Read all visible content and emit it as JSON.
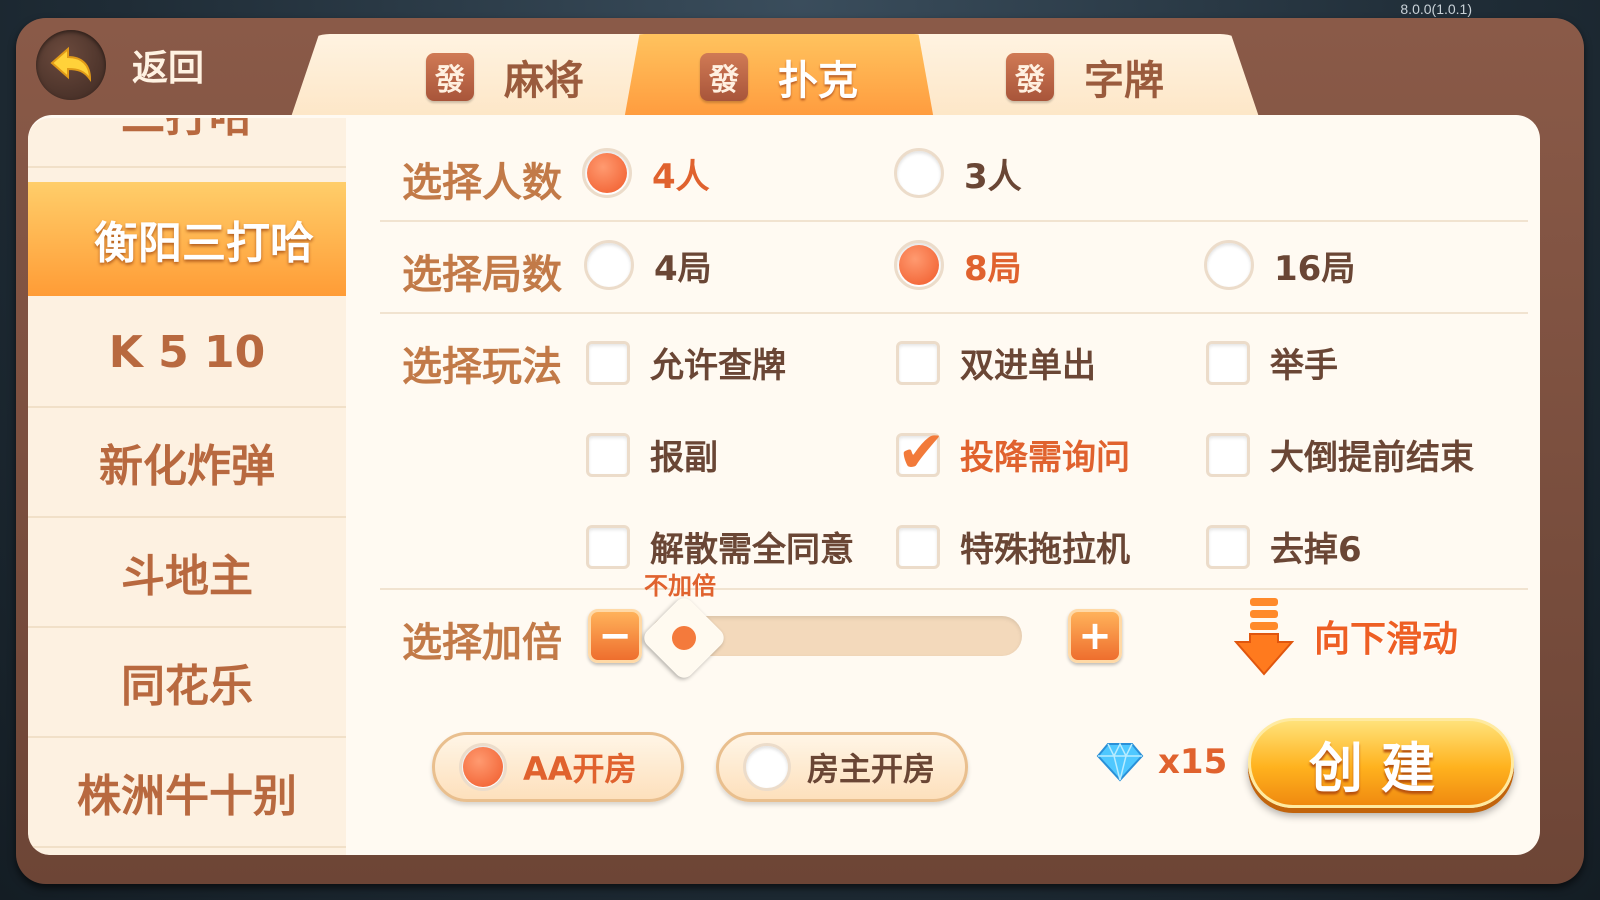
{
  "version": "8.0.0(1.0.1)",
  "back": {
    "label": "返回"
  },
  "tabs": [
    {
      "icon": "發",
      "label": "麻将"
    },
    {
      "icon": "發",
      "label": "扑克"
    },
    {
      "icon": "發",
      "label": "字牌"
    }
  ],
  "active_tab": "扑克",
  "sidebar": {
    "items": [
      {
        "label": "二打哈"
      },
      {
        "label": "衡阳三打哈"
      },
      {
        "label": "K 5 10"
      },
      {
        "label": "新化炸弹"
      },
      {
        "label": "斗地主"
      },
      {
        "label": "同花乐"
      },
      {
        "label": "株洲牛十别"
      }
    ],
    "active": "衡阳三打哈"
  },
  "rows": {
    "players": {
      "label": "选择人数",
      "options": [
        {
          "label": "4人",
          "selected": true
        },
        {
          "label": "3人",
          "selected": false
        }
      ]
    },
    "rounds": {
      "label": "选择局数",
      "options": [
        {
          "label": "4局",
          "selected": false
        },
        {
          "label": "8局",
          "selected": true
        },
        {
          "label": "16局",
          "selected": false
        }
      ]
    },
    "rules": {
      "label": "选择玩法",
      "options": [
        {
          "label": "允许查牌",
          "checked": false
        },
        {
          "label": "双进单出",
          "checked": false
        },
        {
          "label": "举手",
          "checked": false
        },
        {
          "label": "报副",
          "checked": false
        },
        {
          "label": "投降需询问",
          "checked": true
        },
        {
          "label": "大倒提前结束",
          "checked": false
        },
        {
          "label": "解散需全同意",
          "checked": false
        },
        {
          "label": "特殊拖拉机",
          "checked": false
        },
        {
          "label": "去掉6",
          "checked": false
        }
      ]
    },
    "multiplier": {
      "label": "选择加倍",
      "value_text": "不加倍",
      "level": 0,
      "minus": "−",
      "plus": "+"
    }
  },
  "scroll_hint": "向下滑动",
  "payment": {
    "options": [
      {
        "label": "AA开房",
        "selected": true
      },
      {
        "label": "房主开房",
        "selected": false
      }
    ]
  },
  "cost": {
    "icon": "diamond-icon",
    "text": "x15"
  },
  "create_label": "创建",
  "colors": {
    "accent": "#f05a2a",
    "label": "#c27a48",
    "active_tab": "#ff9a3d",
    "create_button": "#ffb21e"
  }
}
